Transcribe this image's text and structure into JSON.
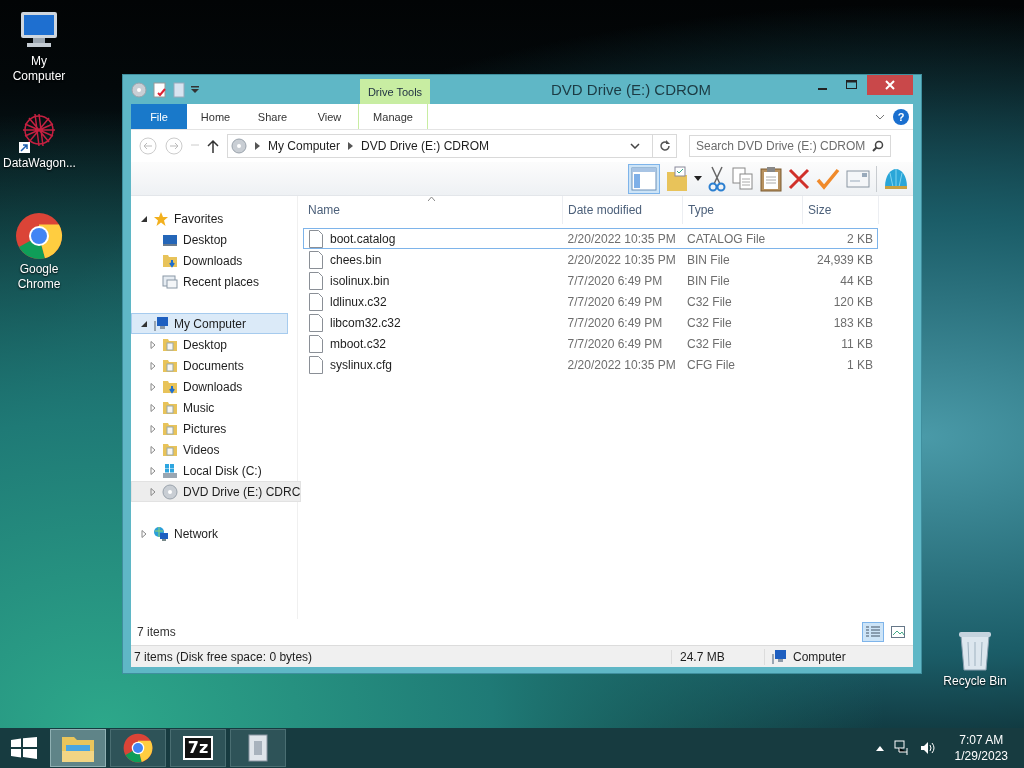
{
  "desktop_icons": [
    {
      "kind": "computer",
      "label": "My Computer"
    },
    {
      "kind": "datawagon",
      "label": "DataWagon..."
    },
    {
      "kind": "chrome",
      "label": "Google Chrome"
    },
    {
      "kind": "recycle",
      "label": "Recycle Bin"
    }
  ],
  "window": {
    "title": "DVD Drive (E:) CDROM",
    "contextual_group": "Drive Tools",
    "ribbon_tabs": [
      {
        "kind": "file",
        "label": "File"
      },
      {
        "kind": "tab",
        "label": "Home"
      },
      {
        "kind": "tab",
        "label": "Share"
      },
      {
        "kind": "tab",
        "label": "View"
      },
      {
        "kind": "contextual",
        "label": "Manage"
      }
    ],
    "help_label": "?",
    "address": [
      "My Computer",
      "DVD Drive (E:) CDROM"
    ],
    "search": {
      "placeholder": "Search DVD Drive (E:) CDROM"
    },
    "toolbar": {
      "layout_pane_selected": true
    },
    "nav": [
      {
        "kind": "star",
        "label": "Favorites",
        "expanded": true,
        "selected": false,
        "hovered": false,
        "children": [
          {
            "kind": "desktop",
            "label": "Desktop",
            "selected": false,
            "hovered": false
          },
          {
            "kind": "downloads",
            "label": "Downloads",
            "selected": false,
            "hovered": false
          },
          {
            "kind": "recent",
            "label": "Recent places",
            "selected": false,
            "hovered": false
          }
        ]
      },
      {
        "kind": "computer",
        "label": "My Computer",
        "expanded": true,
        "selected": true,
        "hovered": false,
        "children": [
          {
            "kind": "folder",
            "label": "Desktop",
            "expanded": false,
            "selected": false,
            "hovered": false
          },
          {
            "kind": "folder",
            "label": "Documents",
            "expanded": false,
            "selected": false,
            "hovered": false
          },
          {
            "kind": "downloads",
            "label": "Downloads",
            "expanded": false,
            "selected": false,
            "hovered": false
          },
          {
            "kind": "folder",
            "label": "Music",
            "expanded": false,
            "selected": false,
            "hovered": false
          },
          {
            "kind": "folder",
            "label": "Pictures",
            "expanded": false,
            "selected": false,
            "hovered": false
          },
          {
            "kind": "folder",
            "label": "Videos",
            "expanded": false,
            "selected": false,
            "hovered": false
          },
          {
            "kind": "disk",
            "label": "Local Disk (C:)",
            "expanded": false,
            "selected": false,
            "hovered": false
          },
          {
            "kind": "dvd",
            "label": "DVD Drive (E:) CDRC",
            "expanded": false,
            "selected": false,
            "hovered": true
          }
        ]
      },
      {
        "kind": "network",
        "label": "Network",
        "expanded": false,
        "selected": false,
        "hovered": false
      }
    ],
    "columns": [
      "Name",
      "Date modified",
      "Type",
      "Size"
    ],
    "rows": [
      {
        "name": "boot.catalog",
        "date": "2/20/2022 10:35 PM",
        "type": "CATALOG File",
        "size": "2 KB",
        "selected": true
      },
      {
        "name": "chees.bin",
        "date": "2/20/2022 10:35 PM",
        "type": "BIN File",
        "size": "24,939 KB",
        "selected": false
      },
      {
        "name": "isolinux.bin",
        "date": "7/7/2020 6:49 PM",
        "type": "BIN File",
        "size": "44 KB",
        "selected": false
      },
      {
        "name": "ldlinux.c32",
        "date": "7/7/2020 6:49 PM",
        "type": "C32 File",
        "size": "120 KB",
        "selected": false
      },
      {
        "name": "libcom32.c32",
        "date": "7/7/2020 6:49 PM",
        "type": "C32 File",
        "size": "183 KB",
        "selected": false
      },
      {
        "name": "mboot.c32",
        "date": "7/7/2020 6:49 PM",
        "type": "C32 File",
        "size": "11 KB",
        "selected": false
      },
      {
        "name": "syslinux.cfg",
        "date": "2/20/2022 10:35 PM",
        "type": "CFG File",
        "size": "1 KB",
        "selected": false
      }
    ],
    "item_count": "7 items",
    "view_buttons": [
      {
        "kind": "details",
        "selected": true
      },
      {
        "kind": "large",
        "selected": false
      }
    ],
    "status_bar": {
      "text": "7 items (Disk free space: 0 bytes)",
      "size": "24.7 MB",
      "location": "Computer"
    }
  },
  "taskbar": {
    "apps": [
      {
        "kind": "explorer",
        "selected": true
      },
      {
        "kind": "chrome",
        "selected": false
      },
      {
        "kind": "sevenzip",
        "label": "7z",
        "selected": false
      },
      {
        "kind": "archive",
        "selected": false
      }
    ],
    "time": "7:07 AM",
    "date": "1/29/2023"
  }
}
